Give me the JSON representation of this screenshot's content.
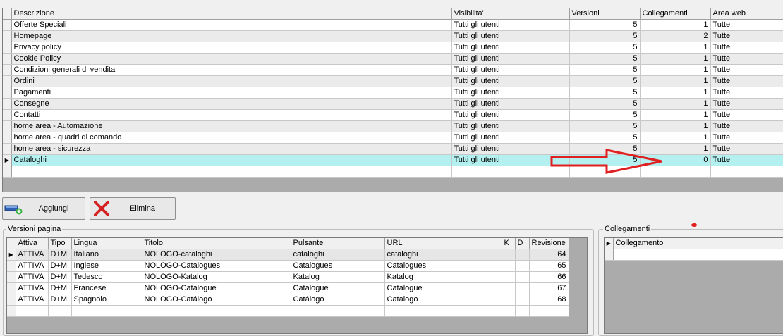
{
  "pages": {
    "columns": [
      "Descrizione",
      "Visibilita'",
      "Versioni",
      "Collegamenti",
      "Area web"
    ],
    "rows": [
      {
        "descrizione": "Offerte Speciali",
        "visibilita": "Tutti gli utenti",
        "versioni": "5",
        "collegamenti": "1",
        "area": "Tutte"
      },
      {
        "descrizione": "Homepage",
        "visibilita": "Tutti gli utenti",
        "versioni": "5",
        "collegamenti": "2",
        "area": "Tutte"
      },
      {
        "descrizione": "Privacy policy",
        "visibilita": "Tutti gli utenti",
        "versioni": "5",
        "collegamenti": "1",
        "area": "Tutte"
      },
      {
        "descrizione": "Cookie Policy",
        "visibilita": "Tutti gli utenti",
        "versioni": "5",
        "collegamenti": "1",
        "area": "Tutte"
      },
      {
        "descrizione": "Condizioni generali di vendita",
        "visibilita": "Tutti gli utenti",
        "versioni": "5",
        "collegamenti": "1",
        "area": "Tutte"
      },
      {
        "descrizione": "Ordini",
        "visibilita": "Tutti gli utenti",
        "versioni": "5",
        "collegamenti": "1",
        "area": "Tutte"
      },
      {
        "descrizione": "Pagamenti",
        "visibilita": "Tutti gli utenti",
        "versioni": "5",
        "collegamenti": "1",
        "area": "Tutte"
      },
      {
        "descrizione": "Consegne",
        "visibilita": "Tutti gli utenti",
        "versioni": "5",
        "collegamenti": "1",
        "area": "Tutte"
      },
      {
        "descrizione": "Contatti",
        "visibilita": "Tutti gli utenti",
        "versioni": "5",
        "collegamenti": "1",
        "area": "Tutte"
      },
      {
        "descrizione": "home area - Automazione",
        "visibilita": "Tutti gli utenti",
        "versioni": "5",
        "collegamenti": "1",
        "area": "Tutte"
      },
      {
        "descrizione": "home area - quadri di comando",
        "visibilita": "Tutti gli utenti",
        "versioni": "5",
        "collegamenti": "1",
        "area": "Tutte"
      },
      {
        "descrizione": "home area - sicurezza",
        "visibilita": "Tutti gli utenti",
        "versioni": "5",
        "collegamenti": "1",
        "area": "Tutte"
      },
      {
        "descrizione": "Cataloghi",
        "visibilita": "Tutti gli utenti",
        "versioni": "5",
        "collegamenti": "0",
        "area": "Tutte"
      }
    ]
  },
  "buttons": {
    "add_label": "Aggiungi",
    "add_icon": "add-page-icon",
    "delete_label": "Elimina",
    "delete_icon": "red-x-icon"
  },
  "versions": {
    "title": "Versioni pagina",
    "columns": [
      "Attiva",
      "Tipo",
      "Lingua",
      "Titolo",
      "Pulsante",
      "URL",
      "K",
      "D",
      "Revisione"
    ],
    "rows": [
      {
        "attiva": "ATTIVA",
        "tipo": "D+M",
        "lingua": "Italiano",
        "titolo": "NOLOGO-cataloghi",
        "pulsante": "cataloghi",
        "url": "cataloghi",
        "k": "",
        "d": "",
        "revisione": "64"
      },
      {
        "attiva": "ATTIVA",
        "tipo": "D+M",
        "lingua": "Inglese",
        "titolo": "NOLOGO-Catalogues",
        "pulsante": "Catalogues",
        "url": "Catalogues",
        "k": "",
        "d": "",
        "revisione": "65"
      },
      {
        "attiva": "ATTIVA",
        "tipo": "D+M",
        "lingua": "Tedesco",
        "titolo": "NOLOGO-Katalog",
        "pulsante": "Katalog",
        "url": "Katalog",
        "k": "",
        "d": "",
        "revisione": "66"
      },
      {
        "attiva": "ATTIVA",
        "tipo": "D+M",
        "lingua": "Francese",
        "titolo": "NOLOGO-Catalogue",
        "pulsante": "Catalogue",
        "url": "Catalogue",
        "k": "",
        "d": "",
        "revisione": "67"
      },
      {
        "attiva": "ATTIVA",
        "tipo": "D+M",
        "lingua": "Spagnolo",
        "titolo": "NOLOGO-Catálogo",
        "pulsante": "Catálogo",
        "url": "Catalogo",
        "k": "",
        "d": "",
        "revisione": "68"
      }
    ]
  },
  "links": {
    "title": "Collegamenti",
    "columns": [
      "Collegamento"
    ]
  },
  "annotation": {
    "arrow_color": "#e02020",
    "selected_row_color": "#b4f0f0"
  }
}
